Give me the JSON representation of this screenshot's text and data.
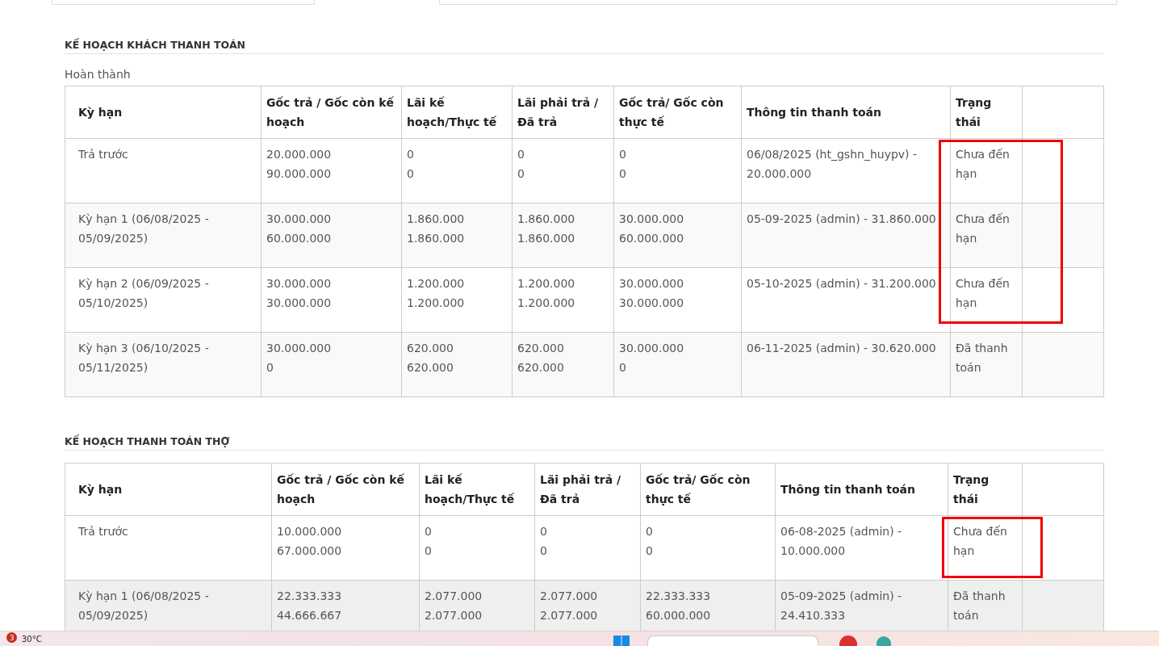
{
  "sections": [
    {
      "title": "KẾ HOẠCH KHÁCH THANH TOÁN",
      "subtitle": "Hoàn thành",
      "columns": [
        "Kỳ hạn",
        "Gốc trả / Gốc còn kế hoạch",
        "Lãi kế hoạch/Thực tế",
        "Lãi phải trả / Đã trả",
        "Gốc trả/ Gốc còn thực tế",
        "Thông tin thanh toán",
        "Trạng thái"
      ],
      "rows": [
        {
          "term": "Trả trước",
          "principal": [
            "20.000.000",
            "90.000.000"
          ],
          "interest_plan": [
            "0",
            "0"
          ],
          "interest_due": [
            "0",
            "0"
          ],
          "principal_actual": [
            "0",
            "0"
          ],
          "payment_info": "06/08/2025 (ht_gshn_huypv) - 20.000.000",
          "status": "Chưa đến hạn",
          "status_marked": true,
          "hovered": false
        },
        {
          "term": "Kỳ hạn 1 (06/08/2025 - 05/09/2025)",
          "principal": [
            "30.000.000",
            "60.000.000"
          ],
          "interest_plan": [
            "1.860.000",
            "1.860.000"
          ],
          "interest_due": [
            "1.860.000",
            "1.860.000"
          ],
          "principal_actual": [
            "30.000.000",
            "60.000.000"
          ],
          "payment_info": "05-09-2025 (admin) - 31.860.000",
          "status": "Chưa đến hạn",
          "status_marked": true,
          "hovered": false
        },
        {
          "term": "Kỳ hạn 2 (06/09/2025 - 05/10/2025)",
          "principal": [
            "30.000.000",
            "30.000.000"
          ],
          "interest_plan": [
            "1.200.000",
            "1.200.000"
          ],
          "interest_due": [
            "1.200.000",
            "1.200.000"
          ],
          "principal_actual": [
            "30.000.000",
            "30.000.000"
          ],
          "payment_info": "05-10-2025 (admin) - 31.200.000",
          "status": "Chưa đến hạn",
          "status_marked": true,
          "hovered": false
        },
        {
          "term": "Kỳ hạn 3 (06/10/2025 - 05/11/2025)",
          "principal": [
            "30.000.000",
            "0"
          ],
          "interest_plan": [
            "620.000",
            "620.000"
          ],
          "interest_due": [
            "620.000",
            "620.000"
          ],
          "principal_actual": [
            "30.000.000",
            "0"
          ],
          "payment_info": "06-11-2025 (admin) - 30.620.000",
          "status": "Đã thanh toán",
          "status_marked": false,
          "hovered": false
        }
      ]
    },
    {
      "title": "KẾ HOẠCH THANH TOÁN THỢ",
      "columns": [
        "Kỳ hạn",
        "Gốc trả / Gốc còn kế hoạch",
        "Lãi kế hoạch/Thực tế",
        "Lãi phải trả / Đã trả",
        "Gốc trả/ Gốc còn thực tế",
        "Thông tin thanh toán",
        "Trạng thái"
      ],
      "rows": [
        {
          "term": "Trả trước",
          "principal": [
            "10.000.000",
            "67.000.000"
          ],
          "interest_plan": [
            "0",
            "0"
          ],
          "interest_due": [
            "0",
            "0"
          ],
          "principal_actual": [
            "0",
            "0"
          ],
          "payment_info": "06-08-2025 (admin) - 10.000.000",
          "status": "Chưa đến hạn",
          "status_marked": true,
          "hovered": false
        },
        {
          "term": "Kỳ hạn 1 (06/08/2025 - 05/09/2025)",
          "principal": [
            "22.333.333",
            "44.666.667"
          ],
          "interest_plan": [
            "2.077.000",
            "2.077.000"
          ],
          "interest_due": [
            "2.077.000",
            "2.077.000"
          ],
          "principal_actual": [
            "22.333.333",
            "60.000.000"
          ],
          "payment_info": "05-09-2025 (admin) - 24.410.333",
          "status": "Đã thanh toán",
          "status_marked": false,
          "hovered": true
        }
      ]
    }
  ],
  "taskbar": {
    "notification_count": "3",
    "temperature": "30°C"
  }
}
